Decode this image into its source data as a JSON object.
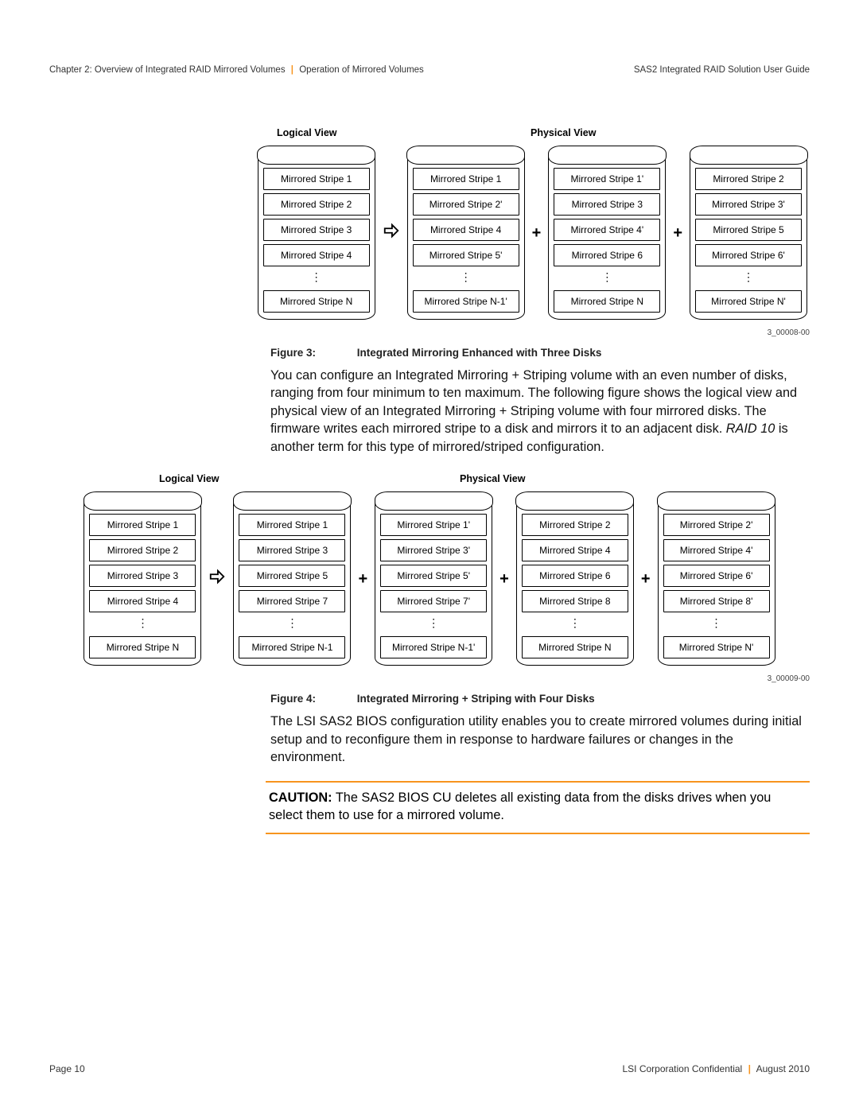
{
  "header": {
    "left_a": "Chapter 2: Overview of Integrated RAID Mirrored Volumes",
    "left_b": "Operation of Mirrored Volumes",
    "right": "SAS2 Integrated RAID Solution User Guide"
  },
  "footer": {
    "left": "Page 10",
    "right_a": "LSI Corporation Confidential",
    "right_b": "August 2010"
  },
  "fig3": {
    "caption_num": "Figure 3:",
    "caption_txt": "Integrated Mirroring Enhanced with Three Disks",
    "tag": "3_00008-00",
    "logical_label": "Logical View",
    "physical_label": "Physical View",
    "logical": [
      "Mirrored Stripe 1",
      "Mirrored Stripe 2",
      "Mirrored Stripe 3",
      "Mirrored Stripe 4",
      "⋮",
      "Mirrored Stripe N"
    ],
    "p1": [
      "Mirrored Stripe 1",
      "Mirrored Stripe 2'",
      "Mirrored Stripe 4",
      "Mirrored Stripe 5'",
      "⋮",
      "Mirrored Stripe N-1'"
    ],
    "p2": [
      "Mirrored Stripe 1'",
      "Mirrored Stripe 3",
      "Mirrored Stripe 4'",
      "Mirrored Stripe 6",
      "⋮",
      "Mirrored Stripe N"
    ],
    "p3": [
      "Mirrored Stripe 2",
      "Mirrored Stripe 3'",
      "Mirrored Stripe 5",
      "Mirrored Stripe 6'",
      "⋮",
      "Mirrored Stripe N'"
    ]
  },
  "para1": "You can configure an Integrated Mirroring + Striping volume with an even number of disks, ranging from four minimum to ten maximum. The following figure shows the logical view and physical view of an Integrated Mirroring + Striping volume with four mirrored disks. The firmware writes each mirrored stripe to a disk and mirrors it to an adjacent disk. ",
  "para1_i": "RAID 10",
  "para1_b": " is another term for this type of mirrored/striped configuration.",
  "fig4": {
    "caption_num": "Figure 4:",
    "caption_txt": "Integrated Mirroring + Striping with Four Disks",
    "tag": "3_00009-00",
    "logical_label": "Logical View",
    "physical_label": "Physical View",
    "logical": [
      "Mirrored Stripe 1",
      "Mirrored Stripe 2",
      "Mirrored Stripe 3",
      "Mirrored Stripe 4",
      "⋮",
      "Mirrored Stripe N"
    ],
    "p1": [
      "Mirrored Stripe 1",
      "Mirrored Stripe 3",
      "Mirrored Stripe 5",
      "Mirrored Stripe 7",
      "⋮",
      "Mirrored Stripe N-1"
    ],
    "p2": [
      "Mirrored Stripe 1'",
      "Mirrored Stripe 3'",
      "Mirrored Stripe 5'",
      "Mirrored Stripe 7'",
      "⋮",
      "Mirrored Stripe N-1'"
    ],
    "p3": [
      "Mirrored Stripe 2",
      "Mirrored Stripe 4",
      "Mirrored Stripe 6",
      "Mirrored Stripe 8",
      "⋮",
      "Mirrored Stripe N"
    ],
    "p4": [
      "Mirrored Stripe 2'",
      "Mirrored Stripe 4'",
      "Mirrored Stripe 6'",
      "Mirrored Stripe 8'",
      "⋮",
      "Mirrored Stripe N'"
    ]
  },
  "para2": "The LSI SAS2 BIOS configuration utility enables you to create mirrored volumes during initial setup and to reconfigure them in response to hardware failures or changes in the environment.",
  "caution_label": "CAUTION:",
  "caution_text": "  The SAS2 BIOS CU deletes all existing data from the disks drives when you select them to use for a mirrored volume."
}
